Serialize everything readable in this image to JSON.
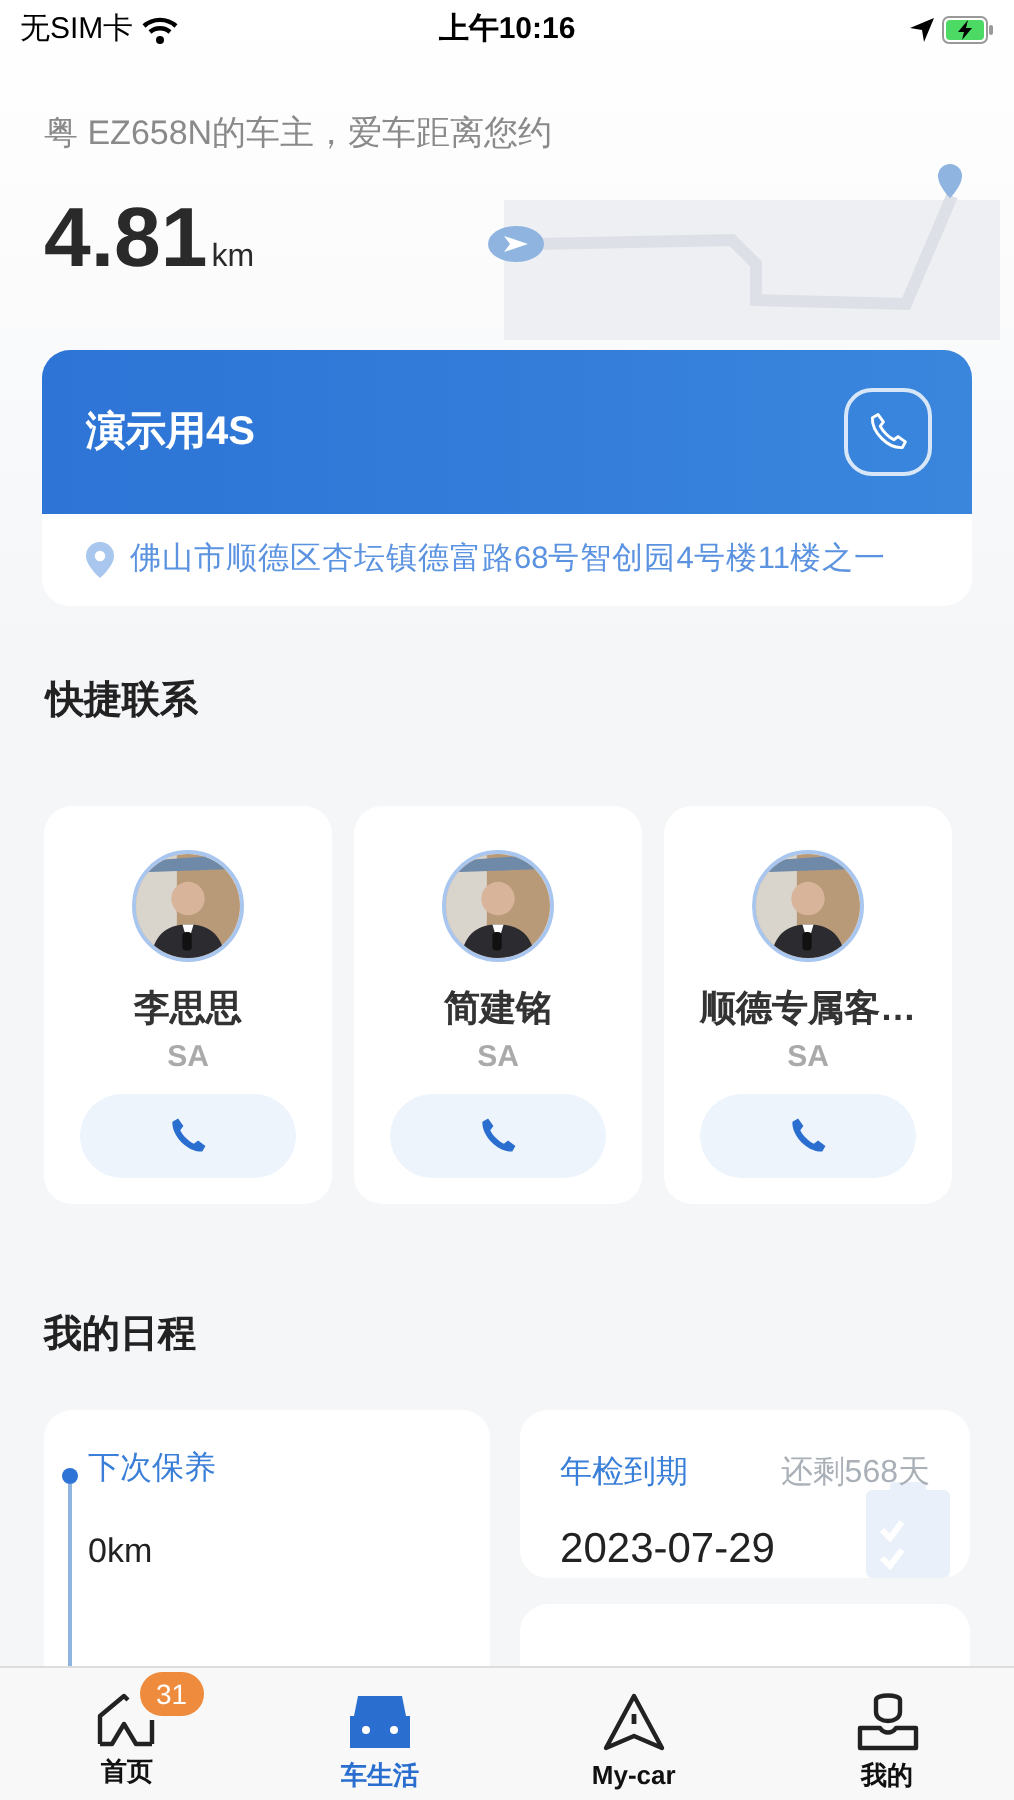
{
  "status_bar": {
    "carrier": "无SIM卡",
    "time": "上午10:16"
  },
  "distance": {
    "caption": "粤 EZ658N的车主，爱车距离您约",
    "value": "4.81",
    "unit": "km"
  },
  "dealer": {
    "name": "演示用4S",
    "address": "佛山市顺德区杏坛镇德富路68号智创园4号楼11楼之一"
  },
  "quick_contacts": {
    "title": "快捷联系",
    "contacts": [
      {
        "name": "李思思",
        "role": "SA"
      },
      {
        "name": "简建铭",
        "role": "SA"
      },
      {
        "name": "顺德专属客…",
        "role": "SA"
      }
    ]
  },
  "schedule": {
    "title": "我的日程",
    "maintenance": {
      "label": "下次保养",
      "value": "0km"
    },
    "inspection": {
      "label": "年检到期",
      "remaining": "还剩568天",
      "date": "2023-07-29"
    }
  },
  "tab_bar": [
    {
      "kind": "home",
      "label": "首页",
      "badge": "31",
      "selected": false
    },
    {
      "kind": "car",
      "label": "车生活",
      "selected": true
    },
    {
      "kind": "nav",
      "label": "My-car",
      "selected": false
    },
    {
      "kind": "user",
      "label": "我的",
      "selected": false
    }
  ]
}
